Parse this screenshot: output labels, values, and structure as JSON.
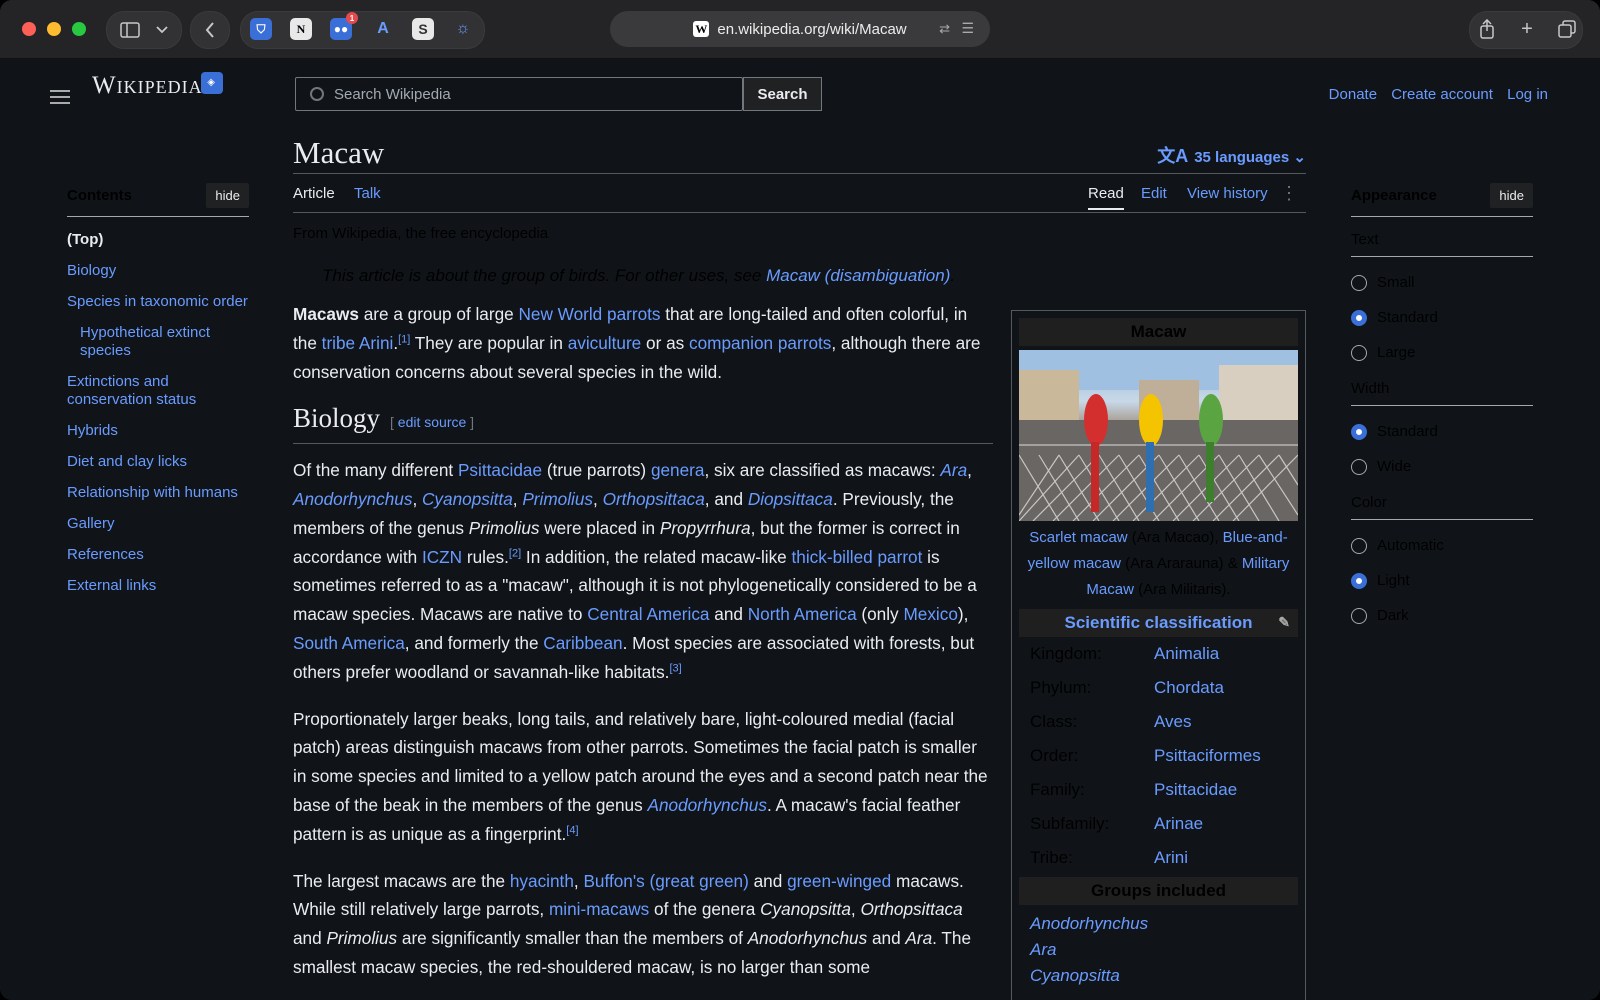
{
  "browser": {
    "url": "en.wikipedia.org/wiki/Macaw",
    "favicon": "W",
    "ext_badge": "1"
  },
  "header": {
    "logo": "Wikipedia",
    "search_placeholder": "Search Wikipedia",
    "search_button": "Search",
    "user_links": [
      "Donate",
      "Create account",
      "Log in"
    ]
  },
  "toc": {
    "title": "Contents",
    "hide": "hide",
    "items": [
      {
        "label": "(Top)",
        "kind": "top"
      },
      {
        "label": "Biology",
        "kind": "item"
      },
      {
        "label": "Species in taxonomic order",
        "kind": "item"
      },
      {
        "label": "Hypothetical extinct species",
        "kind": "sub"
      },
      {
        "label": "Extinctions and conservation status",
        "kind": "item"
      },
      {
        "label": "Hybrids",
        "kind": "item"
      },
      {
        "label": "Diet and clay licks",
        "kind": "item"
      },
      {
        "label": "Relationship with humans",
        "kind": "item"
      },
      {
        "label": "Gallery",
        "kind": "item"
      },
      {
        "label": "References",
        "kind": "item"
      },
      {
        "label": "External links",
        "kind": "item"
      }
    ]
  },
  "article": {
    "title": "Macaw",
    "languages": "35 languages",
    "tabs_left": [
      "Article",
      "Talk"
    ],
    "tabs_right": [
      "Read",
      "Edit",
      "View history"
    ],
    "from": "From Wikipedia, the free encyclopedia",
    "hatnote_text": "This article is about the group of birds. For other uses, see ",
    "hatnote_link": "Macaw (disambiguation)",
    "hatnote_end": ".",
    "section_biology": "Biology",
    "edit_source": "edit source",
    "edit_open": "[ ",
    "edit_close": " ]",
    "p1": [
      {
        "t": "Macaws",
        "s": "b"
      },
      {
        "t": " are a group of large "
      },
      {
        "t": "New World parrots",
        "s": "a"
      },
      {
        "t": " that are long-tailed and often colorful, in the "
      },
      {
        "t": "tribe Arini",
        "s": "a"
      },
      {
        "t": "."
      },
      {
        "t": "[1]",
        "s": "sup"
      },
      {
        "t": " They are popular in "
      },
      {
        "t": "aviculture",
        "s": "a"
      },
      {
        "t": " or as "
      },
      {
        "t": "companion parrots",
        "s": "a"
      },
      {
        "t": ", although there are conservation concerns about several species in the wild."
      }
    ],
    "p2": [
      {
        "t": "Of the many different "
      },
      {
        "t": "Psittacidae",
        "s": "a"
      },
      {
        "t": " (true parrots) "
      },
      {
        "t": "genera",
        "s": "a"
      },
      {
        "t": ", six are classified as macaws: "
      },
      {
        "t": "Ara",
        "s": "ai"
      },
      {
        "t": ", "
      },
      {
        "t": "Anodorhynchus",
        "s": "ai"
      },
      {
        "t": ", "
      },
      {
        "t": "Cyanopsitta",
        "s": "ai"
      },
      {
        "t": ", "
      },
      {
        "t": "Primolius",
        "s": "ai"
      },
      {
        "t": ", "
      },
      {
        "t": "Orthopsittaca",
        "s": "ai"
      },
      {
        "t": ", and "
      },
      {
        "t": "Diopsittaca",
        "s": "ai"
      },
      {
        "t": ". Previously, the members of the genus "
      },
      {
        "t": "Primolius",
        "s": "i"
      },
      {
        "t": " were placed in "
      },
      {
        "t": "Propyrrhura",
        "s": "i"
      },
      {
        "t": ", but the former is correct in accordance with "
      },
      {
        "t": "ICZN",
        "s": "a"
      },
      {
        "t": " rules."
      },
      {
        "t": "[2]",
        "s": "sup"
      },
      {
        "t": " In addition, the related macaw-like "
      },
      {
        "t": "thick-billed parrot",
        "s": "a"
      },
      {
        "t": " is sometimes referred to as a \"macaw\", although it is not phylogenetically considered to be a macaw species. Macaws are native to "
      },
      {
        "t": "Central America",
        "s": "a"
      },
      {
        "t": " and "
      },
      {
        "t": "North America",
        "s": "a"
      },
      {
        "t": " (only "
      },
      {
        "t": "Mexico",
        "s": "a"
      },
      {
        "t": "), "
      },
      {
        "t": "South America",
        "s": "a"
      },
      {
        "t": ", and formerly the "
      },
      {
        "t": "Caribbean",
        "s": "a"
      },
      {
        "t": ". Most species are associated with forests, but others prefer woodland or savannah-like habitats."
      },
      {
        "t": "[3]",
        "s": "sup"
      }
    ],
    "p3": [
      {
        "t": "Proportionately larger beaks, long tails, and relatively bare, light-coloured medial (facial patch) areas distinguish macaws from other parrots. Sometimes the facial patch is smaller in some species and limited to a yellow patch around the eyes and a second patch near the base of the beak in the members of the genus "
      },
      {
        "t": "Anodorhynchus",
        "s": "ai"
      },
      {
        "t": ". A macaw's facial feather pattern is as unique as a fingerprint."
      },
      {
        "t": "[4]",
        "s": "sup"
      }
    ],
    "p4": [
      {
        "t": "The largest macaws are the "
      },
      {
        "t": "hyacinth",
        "s": "a"
      },
      {
        "t": ", "
      },
      {
        "t": "Buffon's (great green)",
        "s": "a"
      },
      {
        "t": " and "
      },
      {
        "t": "green-winged",
        "s": "a"
      },
      {
        "t": " macaws. While still relatively large parrots, "
      },
      {
        "t": "mini-macaws",
        "s": "a"
      },
      {
        "t": " of the genera "
      },
      {
        "t": "Cyanopsitta",
        "s": "i"
      },
      {
        "t": ", "
      },
      {
        "t": "Orthopsittaca",
        "s": "i"
      },
      {
        "t": " and "
      },
      {
        "t": "Primolius",
        "s": "i"
      },
      {
        "t": " are significantly smaller than the members of "
      },
      {
        "t": "Anodorhynchus",
        "s": "i"
      },
      {
        "t": " and "
      },
      {
        "t": "Ara",
        "s": "i"
      },
      {
        "t": ". The smallest macaw species, the red-shouldered macaw, is no larger than some"
      }
    ]
  },
  "infobox": {
    "title": "Macaw",
    "caption": [
      {
        "t": "Scarlet macaw",
        "s": "a"
      },
      {
        "t": " (Ara Macao), "
      },
      {
        "t": "Blue-and-yellow macaw",
        "s": "a"
      },
      {
        "t": " (Ara Ararauna) & "
      },
      {
        "t": "Military Macaw",
        "s": "a"
      },
      {
        "t": " (Ara Militaris)."
      }
    ],
    "classification_title": "Scientific classification",
    "taxonomy": [
      {
        "k": "Kingdom:",
        "v": "Animalia"
      },
      {
        "k": "Phylum:",
        "v": "Chordata"
      },
      {
        "k": "Class:",
        "v": "Aves"
      },
      {
        "k": "Order:",
        "v": "Psittaciformes"
      },
      {
        "k": "Family:",
        "v": "Psittacidae"
      },
      {
        "k": "Subfamily:",
        "v": "Arinae"
      },
      {
        "k": "Tribe:",
        "v": "Arini"
      }
    ],
    "groups_title": "Groups included",
    "groups": [
      "Anodorhynchus",
      "Ara",
      "Cyanopsitta"
    ]
  },
  "appearance": {
    "title": "Appearance",
    "hide": "hide",
    "text_label": "Text",
    "text_options": [
      {
        "label": "Small",
        "on": false
      },
      {
        "label": "Standard",
        "on": true
      },
      {
        "label": "Large",
        "on": false
      }
    ],
    "width_label": "Width",
    "width_options": [
      {
        "label": "Standard",
        "on": true
      },
      {
        "label": "Wide",
        "on": false
      }
    ],
    "color_label": "Color",
    "color_options": [
      {
        "label": "Automatic",
        "on": false
      },
      {
        "label": "Light",
        "on": true
      },
      {
        "label": "Dark",
        "on": false
      }
    ]
  }
}
